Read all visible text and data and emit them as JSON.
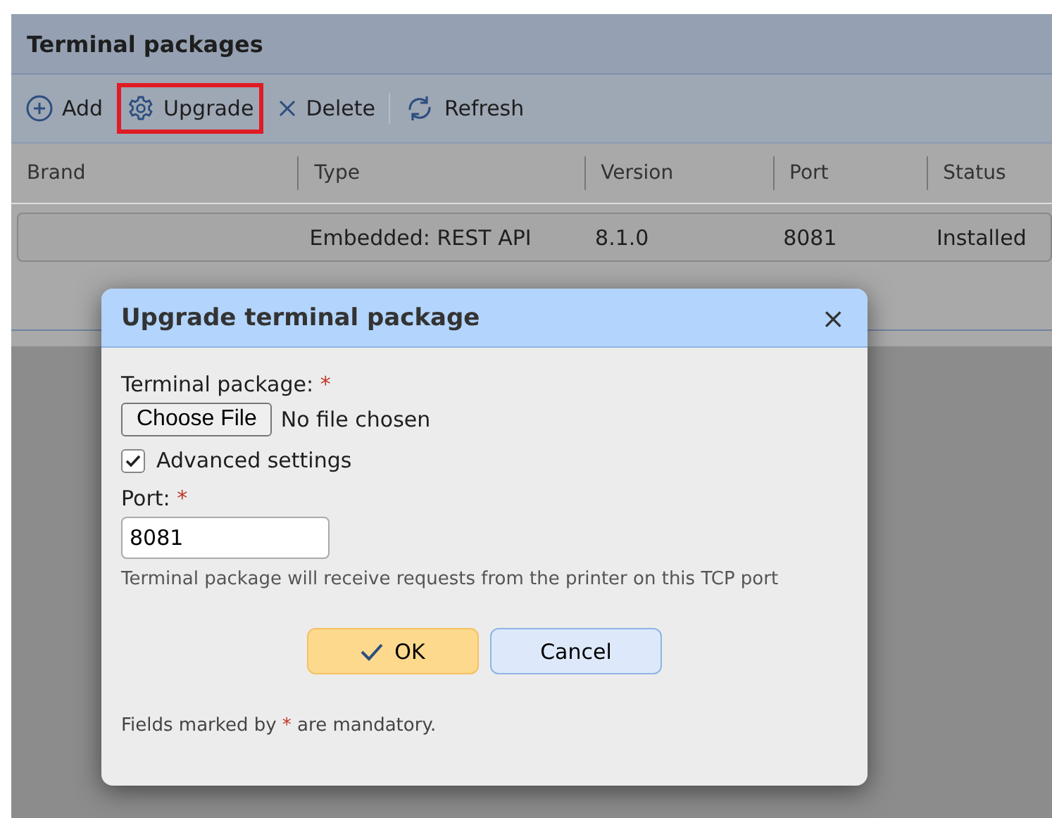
{
  "panel": {
    "title": "Terminal packages"
  },
  "toolbar": [
    {
      "kind": "add",
      "label": "Add",
      "highlighted": false
    },
    {
      "kind": "gear",
      "label": "Upgrade",
      "highlighted": true
    },
    {
      "kind": "delete",
      "label": "Delete",
      "highlighted": false
    },
    {
      "kind": "refresh",
      "label": "Refresh",
      "highlighted": false
    }
  ],
  "table": {
    "columns": [
      "Brand",
      "Type",
      "Version",
      "Port",
      "Status"
    ],
    "rows": [
      {
        "cells": [
          "",
          "Embedded: REST API",
          "8.1.0",
          "8081",
          "Installed"
        ]
      }
    ]
  },
  "dialog": {
    "title": "Upgrade terminal package",
    "close": "×",
    "file_label": "Terminal package:",
    "required_mark": "*",
    "file_button": "Choose File",
    "file_status": "No file chosen",
    "advanced": {
      "label": "Advanced settings",
      "checked": true
    },
    "port_label": "Port:",
    "port_value": "8081",
    "hint": "Terminal package will receive requests from the printer on this TCP port",
    "ok": "OK",
    "cancel": "Cancel",
    "note_before": "Fields marked by",
    "note_mark": "*",
    "note_after": "are mandatory."
  }
}
